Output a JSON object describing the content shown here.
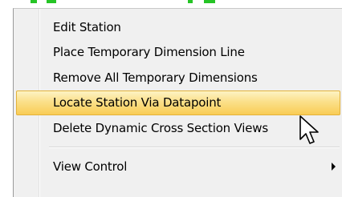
{
  "context_menu": {
    "items": [
      {
        "label": "Edit Station"
      },
      {
        "label": "Place Temporary Dimension Line"
      },
      {
        "label": "Remove All Temporary Dimensions"
      },
      {
        "label": "Locate Station Via Datapoint",
        "highlighted": true
      },
      {
        "label": "Delete Dynamic Cross Section Views"
      },
      {
        "label": "View Control",
        "has_submenu": true
      }
    ]
  },
  "colors": {
    "menu_background": "#f0f0f0",
    "highlight_top": "#fdf3c4",
    "highlight_bottom": "#f9cc55",
    "highlight_border": "#e3b23a"
  },
  "icons": {
    "submenu": "submenu-arrow-icon",
    "pointer": "mouse-pointer-icon"
  }
}
